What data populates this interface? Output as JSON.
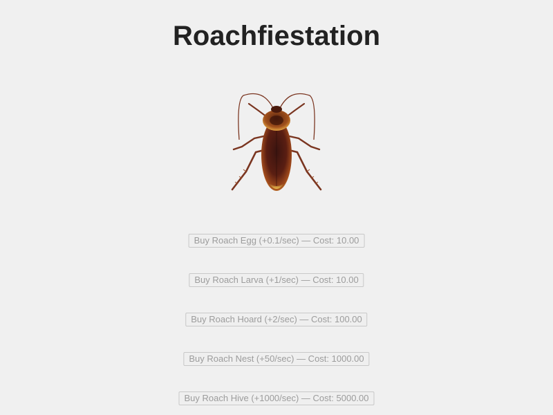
{
  "title": "Roachfiestation",
  "clicker": {
    "icon": "cockroach-icon"
  },
  "upgrades": [
    {
      "label": "Buy Roach Egg (+0.1/sec) — Cost: 10.00",
      "disabled": true
    },
    {
      "label": "Buy Roach Larva (+1/sec) — Cost: 10.00",
      "disabled": true
    },
    {
      "label": "Buy Roach Hoard (+2/sec) — Cost: 100.00",
      "disabled": true
    },
    {
      "label": "Buy Roach Nest (+50/sec) — Cost: 1000.00",
      "disabled": true
    },
    {
      "label": "Buy Roach Hive (+1000/sec) — Cost: 5000.00",
      "disabled": true
    }
  ],
  "colors": {
    "background": "#f0f0f0",
    "title": "#222222",
    "disabled_text": "#9c9c9c",
    "roach_body": "#5a1e12",
    "roach_shell": "#8a3a1a",
    "roach_legs": "#7a3520"
  }
}
